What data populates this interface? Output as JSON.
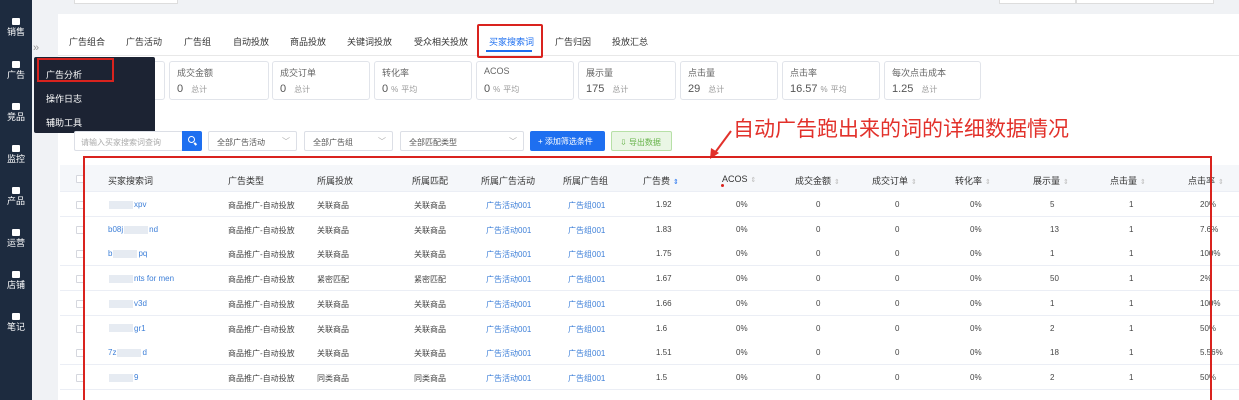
{
  "sidebar": {
    "items": [
      {
        "label": "销售",
        "icon": "sales-icon"
      },
      {
        "label": "广告",
        "icon": "ads-icon"
      },
      {
        "label": "竞品",
        "icon": "competitor-icon"
      },
      {
        "label": "监控",
        "icon": "monitor-icon"
      },
      {
        "label": "产品",
        "icon": "product-icon"
      },
      {
        "label": "运营",
        "icon": "operation-icon"
      },
      {
        "label": "店铺",
        "icon": "store-icon"
      },
      {
        "label": "笔记",
        "icon": "notes-icon"
      }
    ]
  },
  "collapse_glyph": "»",
  "tabs": [
    "广告组合",
    "广告活动",
    "广告组",
    "自动投放",
    "商品投放",
    "关键词投放",
    "受众相关投放",
    "买家搜索词",
    "广告归因",
    "投放汇总"
  ],
  "active_tab_index": 7,
  "popover": {
    "items": [
      "广告分析",
      "操作日志",
      "辅助工具"
    ]
  },
  "metrics": [
    {
      "label": "成交金额",
      "value": "0",
      "unit": "",
      "sum": "总计"
    },
    {
      "label": "成交订单",
      "value": "0",
      "unit": "",
      "sum": "总计"
    },
    {
      "label": "转化率",
      "value": "0",
      "unit": "%",
      "sum": "平均"
    },
    {
      "label": "ACOS",
      "value": "0",
      "unit": "%",
      "sum": "平均"
    },
    {
      "label": "展示量",
      "value": "175",
      "unit": "",
      "sum": "总计"
    },
    {
      "label": "点击量",
      "value": "29",
      "unit": "",
      "sum": "总计"
    },
    {
      "label": "点击率",
      "value": "16.57",
      "unit": "%",
      "sum": "平均"
    },
    {
      "label": "每次点击成本",
      "value": "1.25",
      "unit": "",
      "sum": "总计"
    }
  ],
  "filters": {
    "search_placeholder": "请输入买家搜索词查询",
    "campaign_select": "全部广告活动",
    "group_select": "全部广告组",
    "match_select": "全部匹配类型",
    "add_filter_label": "+ 添加筛选条件",
    "export_label": "导出数据"
  },
  "annotation": "自动广告跑出来的词的详细数据情况",
  "table": {
    "headers": [
      "买家搜索词",
      "广告类型",
      "所属投放",
      "所属匹配",
      "所属广告活动",
      "所属广告组",
      "广告费",
      "ACOS",
      "成交金额",
      "成交订单",
      "转化率",
      "展示量",
      "点击量",
      "点击率"
    ],
    "rows": [
      {
        "term_pre": "",
        "term_post": "xpv",
        "type": "商品推广-自动投放",
        "targeting": "关联商品",
        "match": "关联商品",
        "campaign": "广告活动001",
        "group": "广告组001",
        "spend": "1.92",
        "acos": "0%",
        "sales": "0",
        "orders": "0",
        "cvr": "0%",
        "impr": "5",
        "clicks": "1",
        "ctr": "20%"
      },
      {
        "term_pre": "b08j",
        "term_post": "nd",
        "type": "商品推广-自动投放",
        "targeting": "关联商品",
        "match": "关联商品",
        "campaign": "广告活动001",
        "group": "广告组001",
        "spend": "1.83",
        "acos": "0%",
        "sales": "0",
        "orders": "0",
        "cvr": "0%",
        "impr": "13",
        "clicks": "1",
        "ctr": "7.6%"
      },
      {
        "term_pre": "b",
        "term_post": "pq",
        "type": "商品推广-自动投放",
        "targeting": "关联商品",
        "match": "关联商品",
        "campaign": "广告活动001",
        "group": "广告组001",
        "spend": "1.75",
        "acos": "0%",
        "sales": "0",
        "orders": "0",
        "cvr": "0%",
        "impr": "1",
        "clicks": "1",
        "ctr": "100%"
      },
      {
        "term_pre": "",
        "term_post": "nts for men",
        "type": "商品推广-自动投放",
        "targeting": "紧密匹配",
        "match": "紧密匹配",
        "campaign": "广告活动001",
        "group": "广告组001",
        "spend": "1.67",
        "acos": "0%",
        "sales": "0",
        "orders": "0",
        "cvr": "0%",
        "impr": "50",
        "clicks": "1",
        "ctr": "2%"
      },
      {
        "term_pre": "",
        "term_post": "v3d",
        "type": "商品推广-自动投放",
        "targeting": "关联商品",
        "match": "关联商品",
        "campaign": "广告活动001",
        "group": "广告组001",
        "spend": "1.66",
        "acos": "0%",
        "sales": "0",
        "orders": "0",
        "cvr": "0%",
        "impr": "1",
        "clicks": "1",
        "ctr": "100%"
      },
      {
        "term_pre": "",
        "term_post": "gr1",
        "type": "商品推广-自动投放",
        "targeting": "关联商品",
        "match": "关联商品",
        "campaign": "广告活动001",
        "group": "广告组001",
        "spend": "1.6",
        "acos": "0%",
        "sales": "0",
        "orders": "0",
        "cvr": "0%",
        "impr": "2",
        "clicks": "1",
        "ctr": "50%"
      },
      {
        "term_pre": "7z",
        "term_post": "d",
        "type": "商品推广-自动投放",
        "targeting": "关联商品",
        "match": "关联商品",
        "campaign": "广告活动001",
        "group": "广告组001",
        "spend": "1.51",
        "acos": "0%",
        "sales": "0",
        "orders": "0",
        "cvr": "0%",
        "impr": "18",
        "clicks": "1",
        "ctr": "5.56%"
      },
      {
        "term_pre": "",
        "term_post": "9",
        "type": "商品推广-自动投放",
        "targeting": "同类商品",
        "match": "同类商品",
        "campaign": "广告活动001",
        "group": "广告组001",
        "spend": "1.5",
        "acos": "0%",
        "sales": "0",
        "orders": "0",
        "cvr": "0%",
        "impr": "2",
        "clicks": "1",
        "ctr": "50%"
      }
    ]
  },
  "colors": {
    "sidebar_bg": "#1d2b3f",
    "accent": "#1e6ff0",
    "highlight_red": "#d9231e",
    "link": "#3d7fd8"
  }
}
